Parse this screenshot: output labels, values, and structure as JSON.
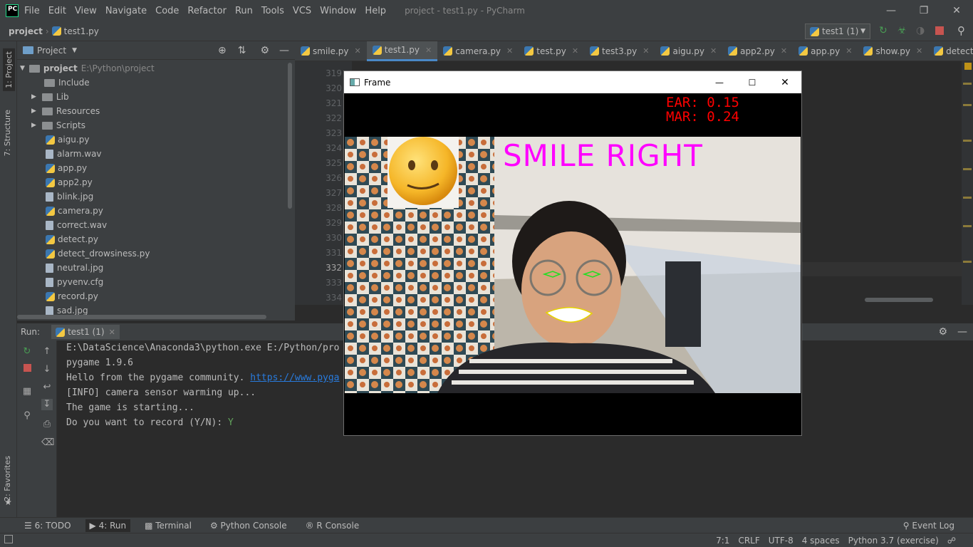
{
  "app": {
    "logo": "PC",
    "title": "project - test1.py - PyCharm"
  },
  "menu": [
    "File",
    "Edit",
    "View",
    "Navigate",
    "Code",
    "Refactor",
    "Run",
    "Tools",
    "VCS",
    "Window",
    "Help"
  ],
  "breadcrumb": {
    "project": "project",
    "file": "test1.py"
  },
  "run_config": {
    "label": "test1 (1)"
  },
  "side_tabs": {
    "project": "1: Project",
    "structure": "7: Structure",
    "favorites": "2: Favorites"
  },
  "project_panel": {
    "title": "Project",
    "root": "project",
    "root_path": "E:\\Python\\project",
    "folders": [
      "Include",
      "Lib",
      "Resources",
      "Scripts"
    ],
    "files": [
      "aigu.py",
      "alarm.wav",
      "app.py",
      "app2.py",
      "blink.jpg",
      "camera.py",
      "correct.wav",
      "detect.py",
      "detect_drowsiness.py",
      "neutral.jpg",
      "pyvenv.cfg",
      "record.py",
      "sad.jpg"
    ]
  },
  "tabs": [
    "smile.py",
    "test1.py",
    "camera.py",
    "test.py",
    "test3.py",
    "aigu.py",
    "app2.py",
    "app.py",
    "show.py",
    "detect.py"
  ],
  "active_tab": "test1.py",
  "line_numbers": [
    "319",
    "320",
    "321",
    "322",
    "323",
    "324",
    "325",
    "326",
    "327",
    "328",
    "329",
    "330",
    "331",
    "332",
    "333",
    "334"
  ],
  "run_panel": {
    "label": "Run:",
    "tab": "test1 (1)"
  },
  "console": {
    "line1": "E:\\DataScience\\Anaconda3\\python.exe E:/Python/pro",
    "line2": "pygame 1.9.6",
    "line3_prefix": "Hello from the pygame community. ",
    "line3_link": "https://www.pyga",
    "line4": "[INFO] camera sensor warming up...",
    "line5": "The game is starting...",
    "line6": "Do you want to record (Y/N): ",
    "line6_input": "Y"
  },
  "frame_window": {
    "title": "Frame",
    "ear": "EAR: 0.15",
    "mar": "MAR: 0.24",
    "overlay": "SMILE RIGHT"
  },
  "toolwindows": {
    "todo": "6: TODO",
    "run": "4: Run",
    "terminal": "Terminal",
    "python_console": "Python Console",
    "r_console": "R Console",
    "event_log": "Event Log"
  },
  "status": {
    "position": "7:1",
    "line_sep": "CRLF",
    "encoding": "UTF-8",
    "indent": "4 spaces",
    "interpreter": "Python 3.7 (exercise)"
  },
  "colors": {
    "accent": "#4a88c7",
    "overlay_text": "#ff00ff",
    "metrics_text": "#ff0000",
    "link": "#287bde",
    "input": "#62a35c"
  }
}
